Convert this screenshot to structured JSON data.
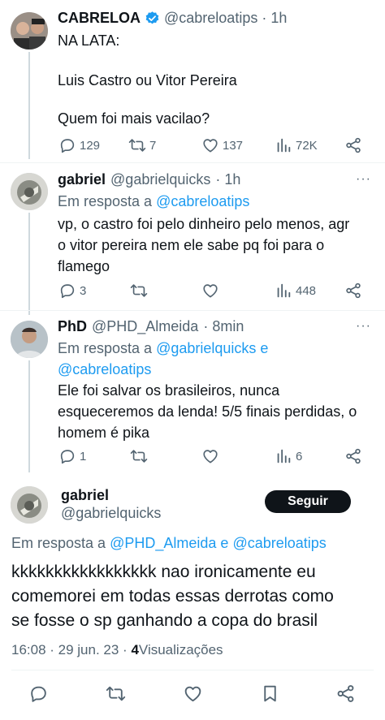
{
  "tweet1": {
    "name": "CABRELOA",
    "handle": "@cabreloatips",
    "time": "· 1h",
    "lines": [
      "NA LATA:",
      "Luis Castro ou Vitor Pereira",
      "Quem foi mais vacilao?"
    ],
    "replies": "129",
    "retweets": "7",
    "likes": "137",
    "views": "72K"
  },
  "tweet2": {
    "name": "gabriel",
    "handle": "@gabrielquicks",
    "time": "· 1h",
    "reply_prefix": "Em resposta a",
    "reply_to": "@cabreloatips",
    "lines": [
      "vp, o castro foi pelo dinheiro pelo menos, agr",
      "o vitor pereira nem ele sabe pq foi para o",
      "flamego"
    ],
    "replies": "3",
    "views": "448"
  },
  "tweet3": {
    "name": "PhD",
    "handle": "@PHD_Almeida",
    "time": "· 8min",
    "reply_prefix": "Em resposta a",
    "reply_to_1": "@gabrielquicks",
    "reply_joiner": "e",
    "reply_to_2": "@cabreloatips",
    "lines": [
      "Ele foi salvar os brasileiros, nunca",
      "esqueceremos da lenda! 5/5 finais perdidas, o",
      "homem é pika"
    ],
    "replies": "1",
    "views": "6"
  },
  "main": {
    "name": "gabriel",
    "handle": "@gabrielquicks",
    "follow_label": "Seguir",
    "reply_prefix": "Em resposta a",
    "reply_to_1": "@PHD_Almeida",
    "reply_joiner": "e",
    "reply_to_2": "@cabreloatips",
    "lines": [
      "kkkkkkkkkkkkkkkkk nao ironicamente eu",
      "comemorei em todas essas derrotas como",
      "se fosse o sp ganhando a copa do brasil"
    ],
    "timestamp": "16:08 · 29 jun. 23 ·",
    "views_count": "4",
    "views_label": "Visualizações"
  },
  "colors": {
    "link": "#1d9bf0",
    "verified": "#1d9bf0",
    "muted": "#536471"
  },
  "icons": [
    "reply-icon",
    "retweet-icon",
    "like-icon",
    "views-icon",
    "share-icon",
    "bookmark-icon",
    "verified-badge-icon",
    "more-icon"
  ]
}
